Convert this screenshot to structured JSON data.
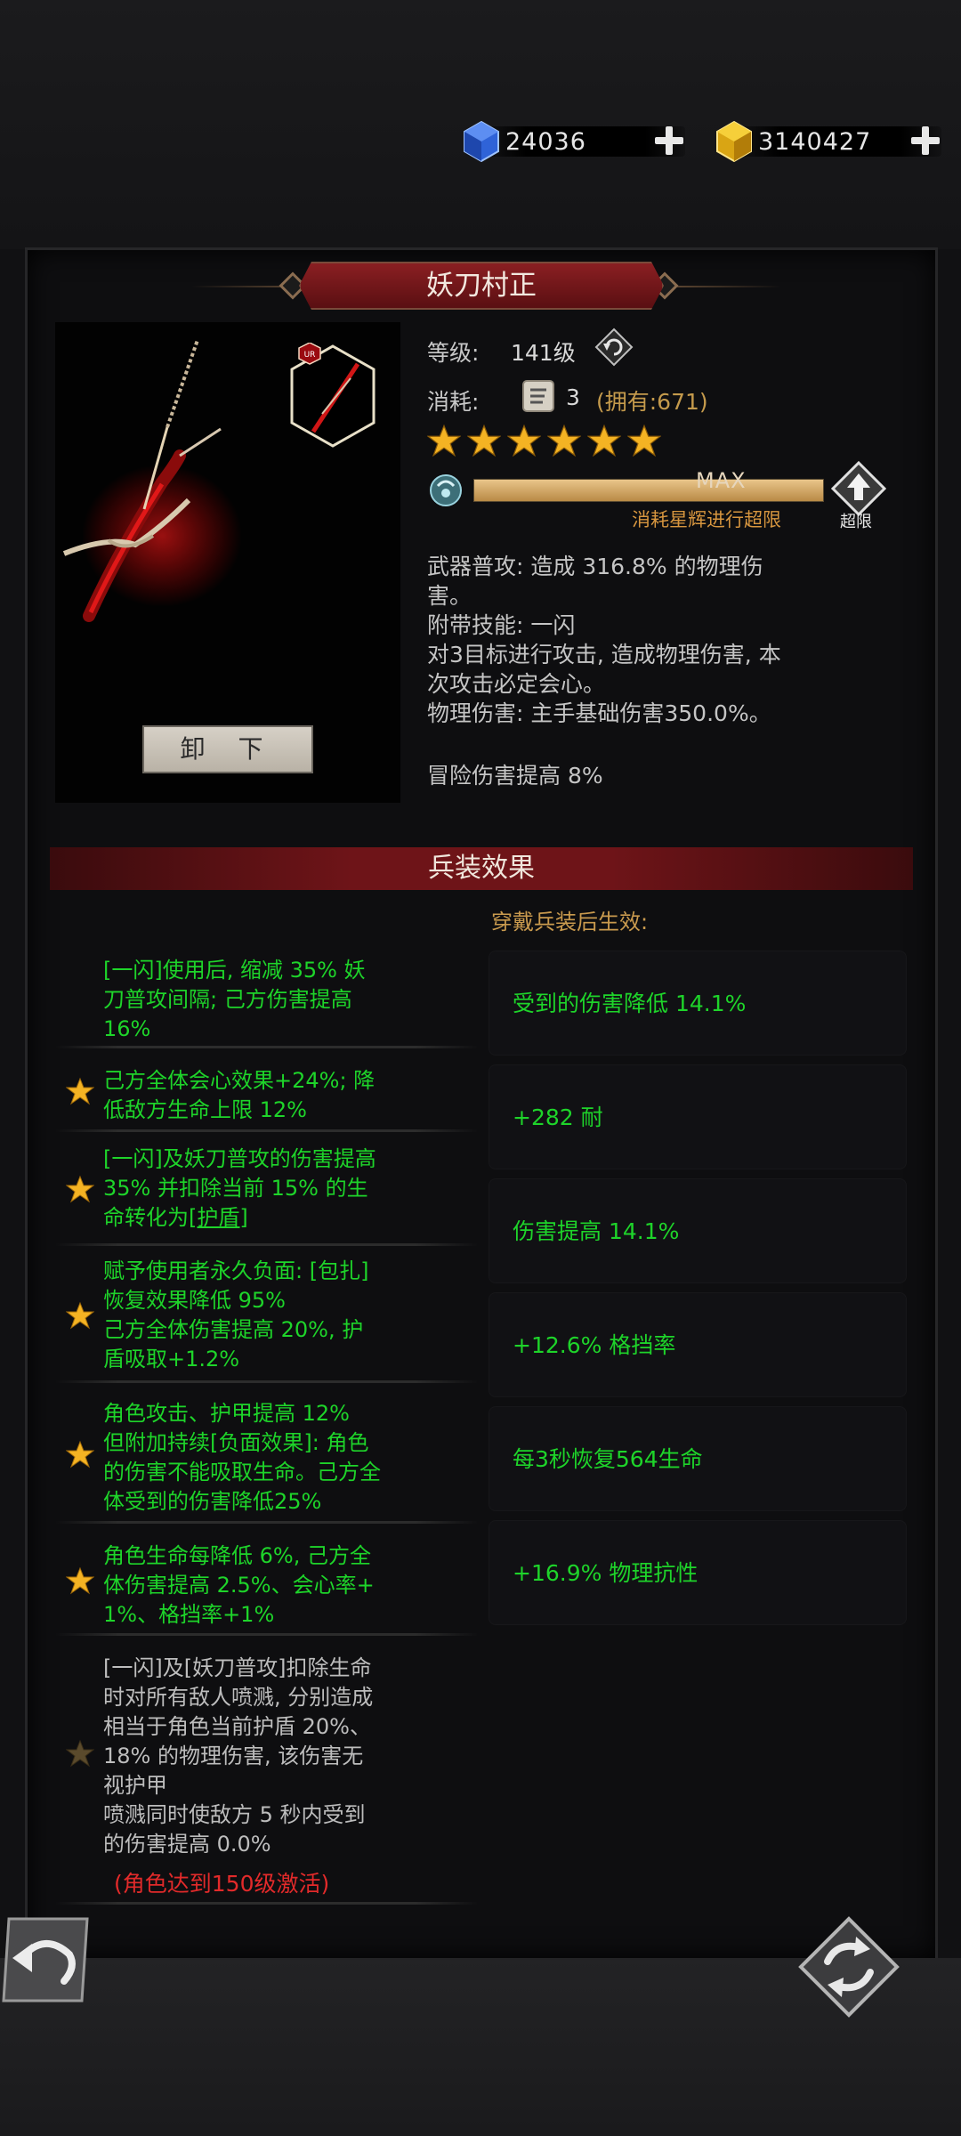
{
  "currency": {
    "gems": "24036",
    "gold": "3140427"
  },
  "weapon": {
    "name": "妖刀村正",
    "rarity_badge": "UR",
    "unequip_label": "卸 下"
  },
  "info": {
    "level_label": "等级:",
    "level_value": "141级",
    "cost_label": "消耗:",
    "cost_amount": "3",
    "cost_owned": "(拥有:671)",
    "stars": 6,
    "xp_max_label": "MAX",
    "xp_progress": 1.0,
    "xp_hint": "消耗星辉进行超限",
    "exceed_label": "超限",
    "description": [
      "武器普攻: 造成 316.8% 的物理伤",
      "害。",
      "附带技能: 一闪",
      "对3目标进行攻击, 造成物理伤害, 本",
      "次攻击必定会心。",
      "物理伤害: 主手基础伤害350.0%。"
    ],
    "adventure_bonus": "冒险伤害提高 8%"
  },
  "effects": {
    "title": "兵装效果",
    "wear_label": "穿戴兵装后生效:",
    "list": [
      {
        "lines": [
          "[一闪]使用后, 缩减 35% 妖",
          "刀普攻间隔; 己方伤害提高",
          "16%"
        ],
        "starred": false
      },
      {
        "lines": [
          "己方全体会心效果+24%; 降",
          "低敌方生命上限 12%"
        ],
        "starred": true
      },
      {
        "lines": [
          "[一闪]及妖刀普攻的伤害提高",
          "35% 并扣除当前 15% 的生",
          "命转化为"
        ],
        "link": "[护盾]",
        "starred": true
      },
      {
        "lines": [
          "赋予使用者永久负面: [包扎]",
          "恢复效果降低 95%",
          "己方全体伤害提高 20%, 护",
          "盾吸取+1.2%"
        ],
        "starred": true
      },
      {
        "lines": [
          "角色攻击、护甲提高 12%",
          "但附加持续[负面效果]: 角色",
          "的伤害不能吸取生命。己方全",
          "体受到的伤害降低25%"
        ],
        "starred": true
      },
      {
        "lines": [
          "角色生命每降低 6%, 己方全",
          "体伤害提高 2.5%、会心率+",
          "1%、格挡率+1%"
        ],
        "starred": true
      },
      {
        "lines": [
          "[一闪]及[妖刀普攻]扣除生命",
          "时对所有敌人喷溅, 分别造成",
          "相当于角色当前护盾 20%、",
          "18% 的物理伤害, 该伤害无",
          "视护甲",
          "喷溅同时使敌方 5 秒内受到",
          "的伤害提高 0.0%"
        ],
        "starred": false,
        "locked": true
      }
    ],
    "locked_note": "(角色达到150级激活)"
  },
  "stats": [
    "受到的伤害降低 14.1%",
    "+282 耐",
    "伤害提高 14.1%",
    "+12.6% 格挡率",
    "每3秒恢复564生命",
    "+16.9% 物理抗性"
  ],
  "colors": {
    "effect_green": "#1ed42a",
    "gold_text": "#c99a4e",
    "banner_red": "#6e1418",
    "locked_red": "#e22a2a"
  }
}
